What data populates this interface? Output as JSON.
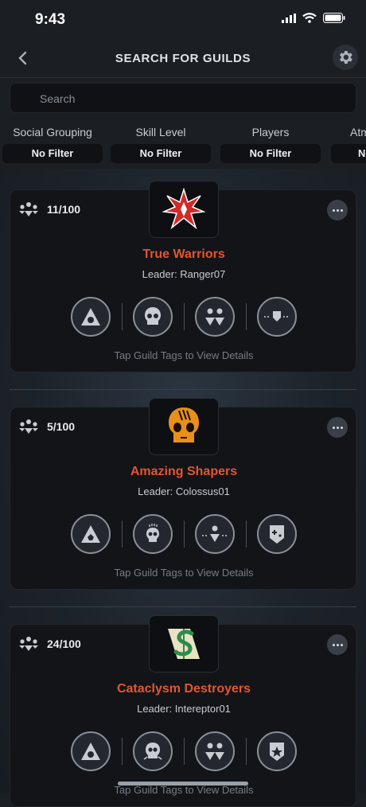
{
  "status": {
    "time": "9:43"
  },
  "header": {
    "title": "SEARCH FOR GUILDS"
  },
  "search": {
    "placeholder": "Search"
  },
  "filters": [
    {
      "label": "Social Grouping",
      "value": "No Filter"
    },
    {
      "label": "Skill Level",
      "value": "No Filter"
    },
    {
      "label": "Players",
      "value": "No Filter"
    },
    {
      "label": "Atm",
      "value": "N"
    }
  ],
  "guilds": [
    {
      "members": "11/100",
      "name": "True Warriors",
      "leader": "Leader: Ranger07",
      "hint": "Tap Guild Tags to View Details",
      "emblem_icon": "red-star-emblem-icon"
    },
    {
      "members": "5/100",
      "name": "Amazing Shapers",
      "leader": "Leader: Colossus01",
      "hint": "Tap Guild Tags to View Details",
      "emblem_icon": "orange-skull-emblem-icon"
    },
    {
      "members": "24/100",
      "name": "Cataclysm Destroyers",
      "leader": "Leader: Intereptor01",
      "hint": "Tap Guild Tags to View Details",
      "emblem_icon": "green-s-scroll-emblem-icon"
    }
  ],
  "colors": {
    "accent": "#e4552f",
    "background": "#1b1e23"
  }
}
